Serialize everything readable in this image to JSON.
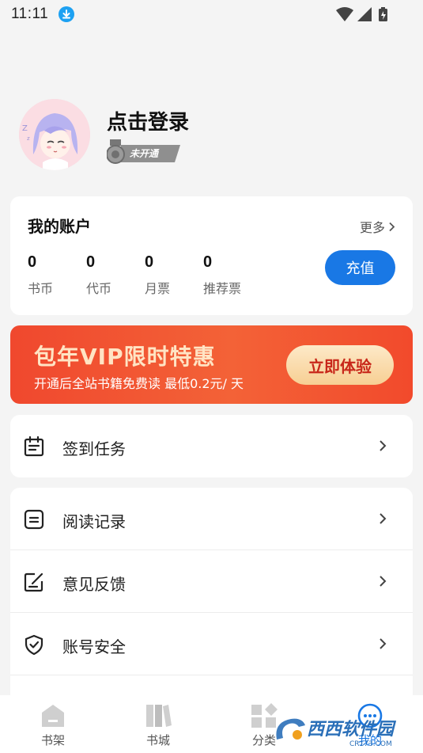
{
  "status_bar": {
    "time": "11:11"
  },
  "profile": {
    "login_text": "点击登录",
    "level_badge": "未开通"
  },
  "account": {
    "title": "我的账户",
    "more": "更多",
    "stats": [
      {
        "value": "0",
        "label": "书币"
      },
      {
        "value": "0",
        "label": "代币"
      },
      {
        "value": "0",
        "label": "月票"
      },
      {
        "value": "0",
        "label": "推荐票"
      }
    ],
    "recharge": "充值"
  },
  "vip": {
    "title": "包年VIP限时特惠",
    "subtitle": "开通后全站书籍免费读 最低0.2元/ 天",
    "button": "立即体验"
  },
  "menu": {
    "checkin": "签到任务",
    "history": "阅读记录",
    "feedback": "意见反馈",
    "security": "账号安全"
  },
  "bottom_nav": [
    {
      "label": "书架"
    },
    {
      "label": "书城"
    },
    {
      "label": "分类"
    },
    {
      "label": "我的"
    }
  ],
  "watermark": {
    "text": "西西软件园",
    "sub": "CR173.COM"
  },
  "colors": {
    "accent": "#1978e5",
    "vip_red": "#f0482e",
    "vip_gold": "#f7cf93"
  }
}
